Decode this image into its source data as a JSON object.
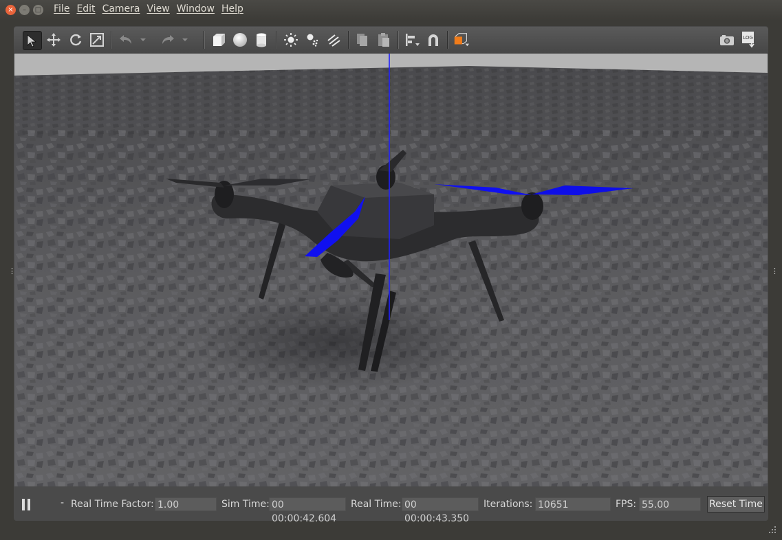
{
  "window": {
    "close_glyph": "×",
    "minimize_glyph": "–",
    "maximize_glyph": "□"
  },
  "menu": {
    "items": [
      "File",
      "Edit",
      "Camera",
      "View",
      "Window",
      "Help"
    ]
  },
  "toolbar": {
    "tools": [
      "select-arrow-icon",
      "translate-icon",
      "rotate-icon",
      "scale-icon",
      "undo-icon",
      "undo-dropdown-icon",
      "redo-icon",
      "redo-dropdown-icon",
      "box-shape-icon",
      "sphere-shape-icon",
      "cylinder-shape-icon",
      "point-light-icon",
      "spot-light-icon",
      "directional-light-icon",
      "copy-icon",
      "paste-icon",
      "align-icon",
      "snap-magnet-icon",
      "view-angle-icon",
      "screenshot-camera-icon",
      "log-icon"
    ],
    "log_text": "LOG",
    "accent_color": "#f07c1b"
  },
  "status": {
    "pause_icon": "pause-icon",
    "step_glyph": "-",
    "real_time_factor_label": "Real Time Factor:",
    "real_time_factor_value": "1.00",
    "sim_time_label": "Sim Time:",
    "sim_time_value": "00 00:00:42.604",
    "real_time_label": "Real Time:",
    "real_time_value": "00 00:00:43.350",
    "iterations_label": "Iterations:",
    "iterations_value": "10651",
    "fps_label": "FPS:",
    "fps_value": "55.00",
    "reset_button": "Reset Time"
  },
  "scene": {
    "sky_color": "#b5b5b5",
    "ground_color": "#5d5d60",
    "drone_color": "#2b2b2d",
    "propeller_color": "#1010f0",
    "axis_color": "#2020ff"
  }
}
